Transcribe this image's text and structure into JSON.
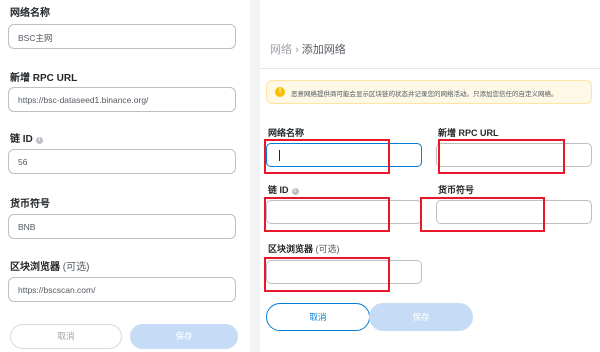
{
  "left_form": {
    "network_name_label": "网络名称",
    "network_name_value": "BSC主网",
    "rpc_url_label": "新增 RPC URL",
    "rpc_url_value": "https://bsc-dataseed1.binance.org/",
    "chain_id_label": "链 ID",
    "chain_id_value": "56",
    "currency_symbol_label": "货币符号",
    "currency_symbol_value": "BNB",
    "explorer_label": "区块浏览器",
    "explorer_optional": "(可选)",
    "explorer_value": "https://bscscan.com/",
    "cancel_label": "取消",
    "save_label": "保存"
  },
  "right_form": {
    "breadcrumb_parent": "网络",
    "breadcrumb_sep": "›",
    "breadcrumb_current": "添加网络",
    "warning_text": "恶意网络提供商可能会显示区块链的状态并记录您的网络活动。只添加您信任的自定义网络。",
    "network_name_label": "网络名称",
    "rpc_url_label": "新增 RPC URL",
    "chain_id_label": "链 ID",
    "currency_symbol_label": "货币符号",
    "explorer_label": "区块浏览器",
    "explorer_optional": "(可选)",
    "cancel_label": "取消",
    "save_label": "保存"
  },
  "icons": {
    "info": "info-icon",
    "warning": "warning-icon"
  },
  "colors": {
    "primary": "#037dd6",
    "save_disabled": "#c6dcf6",
    "annotation_red": "#e8182a",
    "warning_bg": "#fef8e6"
  }
}
